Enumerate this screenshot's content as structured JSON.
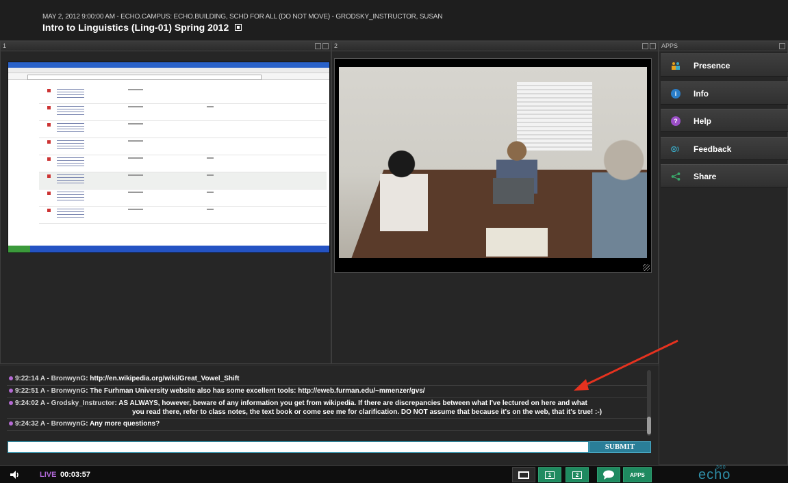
{
  "header": {
    "meta": "MAY 2, 2012 9:00:00 AM - ECHO.CAMPUS: ECHO.BUILDING, SCHD FOR ALL (DO NOT MOVE) - GRODSKY_INSTRUCTOR, SUSAN",
    "title": "Intro to Linguistics (Ling-01) Spring 2012"
  },
  "panels": {
    "p1": "1",
    "p2": "2",
    "apps": "APPS"
  },
  "apps": [
    {
      "label": "Presence",
      "icon": "presence-icon",
      "color": "#e6a21a"
    },
    {
      "label": "Info",
      "icon": "info-icon",
      "color": "#2a7ec9"
    },
    {
      "label": "Help",
      "icon": "help-icon",
      "color": "#9b4fc7"
    },
    {
      "label": "Feedback",
      "icon": "feedback-icon",
      "color": "#3aa8c4"
    },
    {
      "label": "Share",
      "icon": "share-icon",
      "color": "#3aa86b"
    }
  ],
  "chat": {
    "messages": [
      {
        "time": "9:22:14 A",
        "user": "BronwynG",
        "text": "http://en.wikipedia.org/wiki/Great_Vowel_Shift"
      },
      {
        "time": "9:22:51 A",
        "user": "BronwynG",
        "text": "The Furhman University website also has some excellent tools: http://eweb.furman.edu/~mmenzer/gvs/"
      },
      {
        "time": "9:24:02 A",
        "user": "Grodsky_Instructor",
        "text": "AS ALWAYS, however, beware of any information you get from wikipedia. If there are discrepancies between what I've lectured on here and what",
        "text2": "you read there, refer to class notes, the text book or come see me for clarification. DO NOT assume that because it's on the web, that it's true! :-)"
      },
      {
        "time": "9:24:32 A",
        "user": "BronwynG",
        "text": "Any more questions?"
      }
    ],
    "input_value": "",
    "submit_label": "SUBMIT"
  },
  "bottom": {
    "live_label": "LIVE",
    "time": "00:03:57",
    "btn_one": "1",
    "btn_two": "2",
    "btn_apps": "APPS",
    "logo": "echo",
    "logo_sup": "360"
  },
  "colors": {
    "accent": "#2a7e98",
    "live": "#b068d8",
    "green": "#1f8a60",
    "arrow": "#e5321f"
  }
}
